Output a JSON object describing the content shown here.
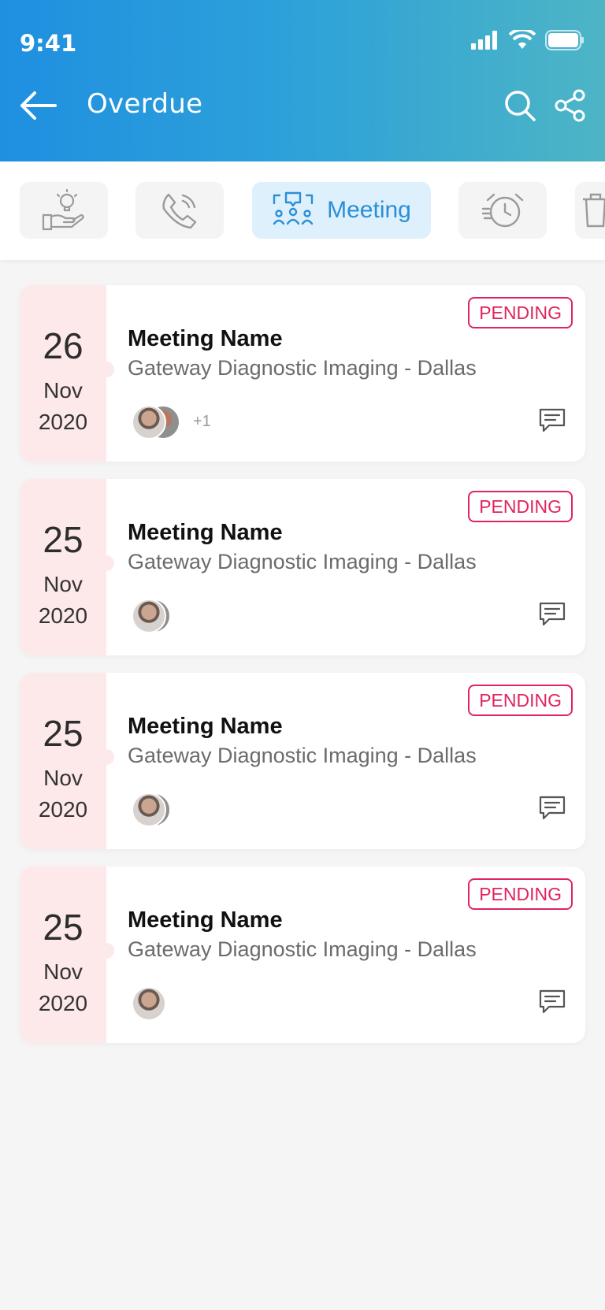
{
  "status_bar": {
    "time": "9:41"
  },
  "header": {
    "title": "Overdue"
  },
  "filters": {
    "active_label": "Meeting",
    "chips": [
      "idea-hand-icon",
      "phone-call-icon",
      "meeting-icon",
      "alarm-clock-icon",
      "trash-icon"
    ]
  },
  "colors": {
    "accent": "#2a8fd6",
    "pending": "#e0245e",
    "date_bg": "#fde9ea"
  },
  "cards": [
    {
      "day": "26",
      "month": "Nov",
      "year": "2020",
      "status": "PENDING",
      "title": "Meeting Name",
      "subtitle": "Gateway Diagnostic Imaging - Dallas",
      "extra_count": "+1"
    },
    {
      "day": "25",
      "month": "Nov",
      "year": "2020",
      "status": "PENDING",
      "title": "Meeting Name",
      "subtitle": "Gateway Diagnostic Imaging - Dallas",
      "extra_count": ""
    },
    {
      "day": "25",
      "month": "Nov",
      "year": "2020",
      "status": "PENDING",
      "title": "Meeting Name",
      "subtitle": "Gateway Diagnostic Imaging - Dallas",
      "extra_count": ""
    },
    {
      "day": "25",
      "month": "Nov",
      "year": "2020",
      "status": "PENDING",
      "title": "Meeting Name",
      "subtitle": "Gateway Diagnostic Imaging - Dallas",
      "extra_count": ""
    }
  ]
}
